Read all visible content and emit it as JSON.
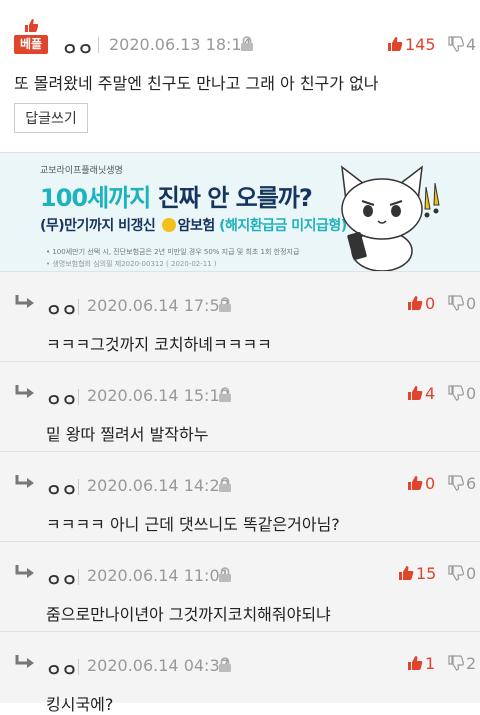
{
  "top_comment": {
    "badge": "베플",
    "nickname": "ㅇㅇ",
    "date": "2020.06.13 18:14",
    "upvotes": "145",
    "downvotes": "4",
    "text": "또 몰려왔네 주말엔 친구도 만나고 그래 아 친구가 없나",
    "reply_button": "답글쓰기"
  },
  "ad": {
    "company": "교보라이프플래닛생명",
    "headline_1": "100세까지",
    "headline_2": " 진짜 안 오를까?",
    "sub_1": "(무)만기까지 비갱신",
    "sub_2": "암보험",
    "sub_3": "(해지환급금 미지급형)",
    "fine_1": "• 100세만기 선택 시, 진단보험금은 2년 미만일 경우 50% 지급 및 최초 1회 한정지급",
    "fine_2": "• 생명보험협회 심의필 제2020-00312 ( 2020-02-11 )"
  },
  "replies": [
    {
      "nickname": "ㅇㅇ",
      "date": "2020.06.14 17:53",
      "upvotes": "0",
      "downvotes": "0",
      "text": "ㅋㅋㅋ그것까지 코치하녜ㅋㅋㅋㅋ"
    },
    {
      "nickname": "ㅇㅇ",
      "date": "2020.06.14 15:19",
      "upvotes": "4",
      "downvotes": "0",
      "text": "밑 왕따 찔려서 발작하누"
    },
    {
      "nickname": "ㅇㅇ",
      "date": "2020.06.14 14:29",
      "upvotes": "0",
      "downvotes": "6",
      "text": "ㅋㅋㅋㅋ 아니 근데 댓쓰니도 똑같은거아님?"
    },
    {
      "nickname": "ㅇㅇ",
      "date": "2020.06.14 11:01",
      "upvotes": "15",
      "downvotes": "0",
      "text": "줌으로만나이년아 그것까지코치해줘야되냐"
    },
    {
      "nickname": "ㅇㅇ",
      "date": "2020.06.14 04:37",
      "upvotes": "1",
      "downvotes": "2",
      "text": "킹시국에?"
    }
  ],
  "colors": {
    "accent": "#e0452b",
    "muted": "#999999",
    "ad_navy": "#15345f",
    "ad_teal": "#1eb2bc"
  },
  "icons": [
    "best-thumb-icon",
    "lock-icon",
    "thumbs-up-icon",
    "thumbs-down-icon",
    "reply-arrow-icon"
  ]
}
